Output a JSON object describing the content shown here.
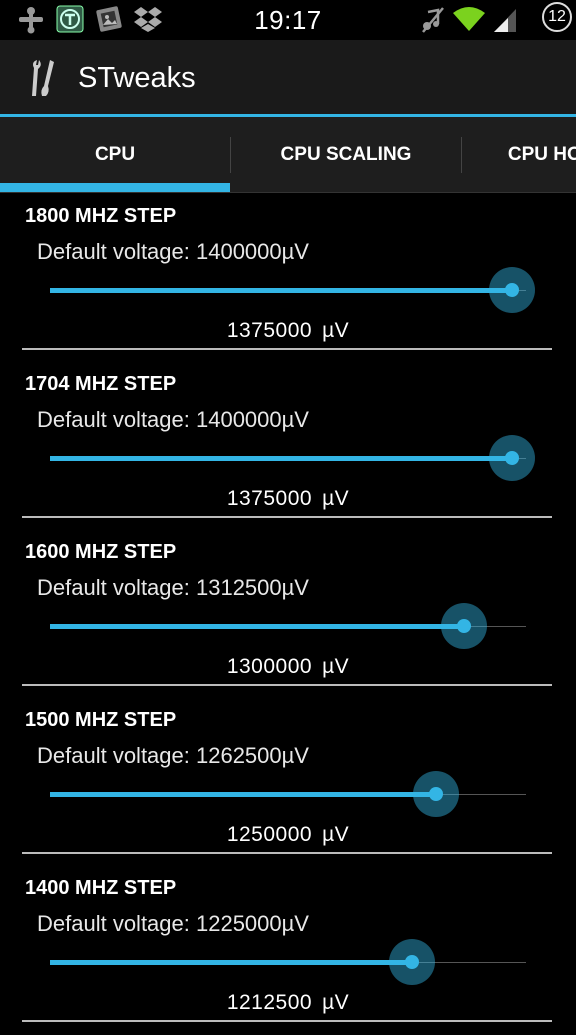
{
  "status_bar": {
    "time": "19:17",
    "battery_level": "12",
    "left_icons": [
      "usb-icon",
      "shield-app-icon",
      "photo-app-icon",
      "dropbox-icon"
    ],
    "right_icons": [
      "mute-icon",
      "wifi-icon",
      "signal-icon"
    ]
  },
  "app": {
    "title": "STweaks",
    "icon": "tools-icon"
  },
  "tabs": [
    {
      "label": "CPU",
      "selected": true
    },
    {
      "label": "CPU SCALING",
      "selected": false
    },
    {
      "label": "CPU HOTPLUG",
      "selected": false
    }
  ],
  "accent_color": "#33b5e5",
  "steps": [
    {
      "title": "1800 MHZ STEP",
      "default_label": "Default voltage: 1400000µV",
      "value": "1375000",
      "unit": "µV",
      "slider_fraction": 0.97
    },
    {
      "title": "1704 MHZ STEP",
      "default_label": "Default voltage: 1400000µV",
      "value": "1375000",
      "unit": "µV",
      "slider_fraction": 0.97
    },
    {
      "title": "1600 MHZ STEP",
      "default_label": "Default voltage: 1312500µV",
      "value": "1300000",
      "unit": "µV",
      "slider_fraction": 0.87
    },
    {
      "title": "1500 MHZ STEP",
      "default_label": "Default voltage: 1262500µV",
      "value": "1250000",
      "unit": "µV",
      "slider_fraction": 0.81
    },
    {
      "title": "1400 MHZ STEP",
      "default_label": "Default voltage: 1225000µV",
      "value": "1212500",
      "unit": "µV",
      "slider_fraction": 0.76
    }
  ]
}
